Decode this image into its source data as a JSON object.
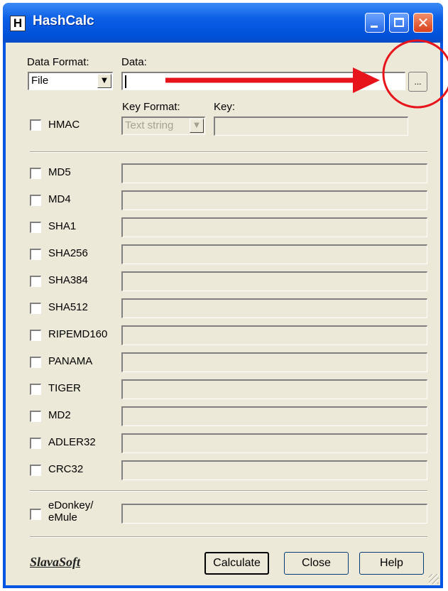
{
  "window": {
    "title": "HashCalc",
    "icon_letter": "H"
  },
  "data_section": {
    "format_label": "Data Format:",
    "format_value": "File",
    "data_label": "Data:",
    "data_value": "",
    "browse_label": "..."
  },
  "hmac": {
    "label": "HMAC",
    "key_format_label": "Key Format:",
    "key_format_value": "Text string",
    "key_label": "Key:"
  },
  "algorithms": [
    "MD5",
    "MD4",
    "SHA1",
    "SHA256",
    "SHA384",
    "SHA512",
    "RIPEMD160",
    "PANAMA",
    "TIGER",
    "MD2",
    "ADLER32",
    "CRC32"
  ],
  "edonkey": {
    "line1": "eDonkey/",
    "line2": "eMule"
  },
  "footer": {
    "logo": "SlavaSoft",
    "calculate": "Calculate",
    "close": "Close",
    "help": "Help"
  },
  "annotation_colors": {
    "arrow": "#e8141b",
    "circle": "#e8141b"
  }
}
